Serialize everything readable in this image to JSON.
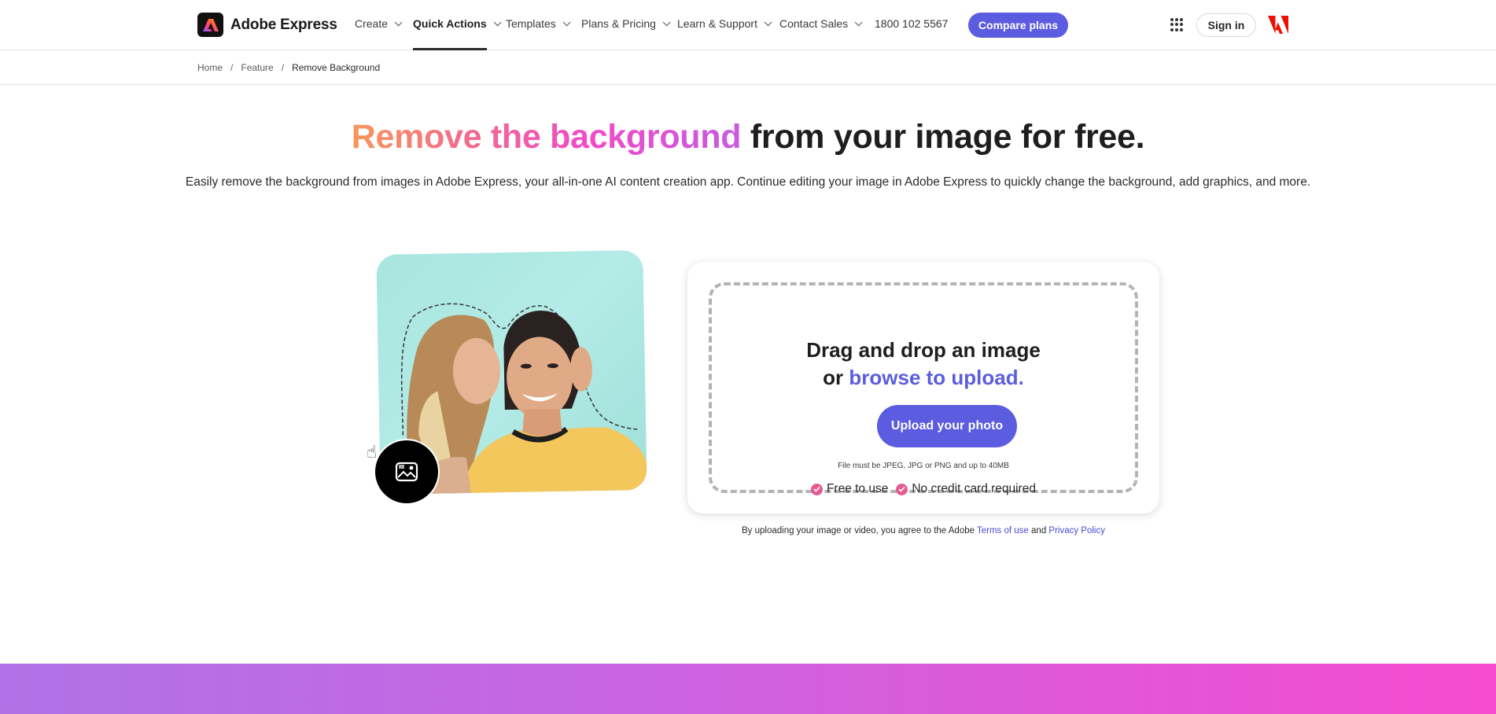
{
  "header": {
    "brand": "Adobe Express",
    "nav": [
      {
        "label": "Create"
      },
      {
        "label": "Quick Actions",
        "active": true
      },
      {
        "label": "Templates"
      },
      {
        "label": "Plans & Pricing"
      },
      {
        "label": "Learn & Support"
      },
      {
        "label": "Contact Sales"
      }
    ],
    "phone": "1800 102 5567",
    "compare_label": "Compare plans",
    "signin_label": "Sign in",
    "apps_icon": "app-grid-icon",
    "adobe_icon": "adobe-logo-icon"
  },
  "breadcrumb": {
    "items": [
      "Home",
      "Feature",
      "Remove Background"
    ],
    "separator": "/"
  },
  "hero": {
    "title_highlight": "Remove the background",
    "title_rest": " from your image for free.",
    "subtitle": "Easily remove the background from images in Adobe Express, your all-in-one AI content creation app. Continue editing your image in Adobe Express to quickly change the background, add graphics, and more."
  },
  "upload": {
    "title_line1": "Drag and drop an image",
    "title_or": "or ",
    "title_browse": "browse to upload.",
    "button_label": "Upload your photo",
    "file_note": "File must be JPEG, JPG or PNG and up to 40MB",
    "perks": [
      "Free to use",
      "No credit card required"
    ]
  },
  "terms": {
    "prefix": "By uploading your image or video, you agree to the Adobe ",
    "terms_link": "Terms of use",
    "and": " and ",
    "privacy_link": "Privacy Policy"
  },
  "colors": {
    "accent": "#5c5ce0",
    "check": "#e45b92"
  }
}
